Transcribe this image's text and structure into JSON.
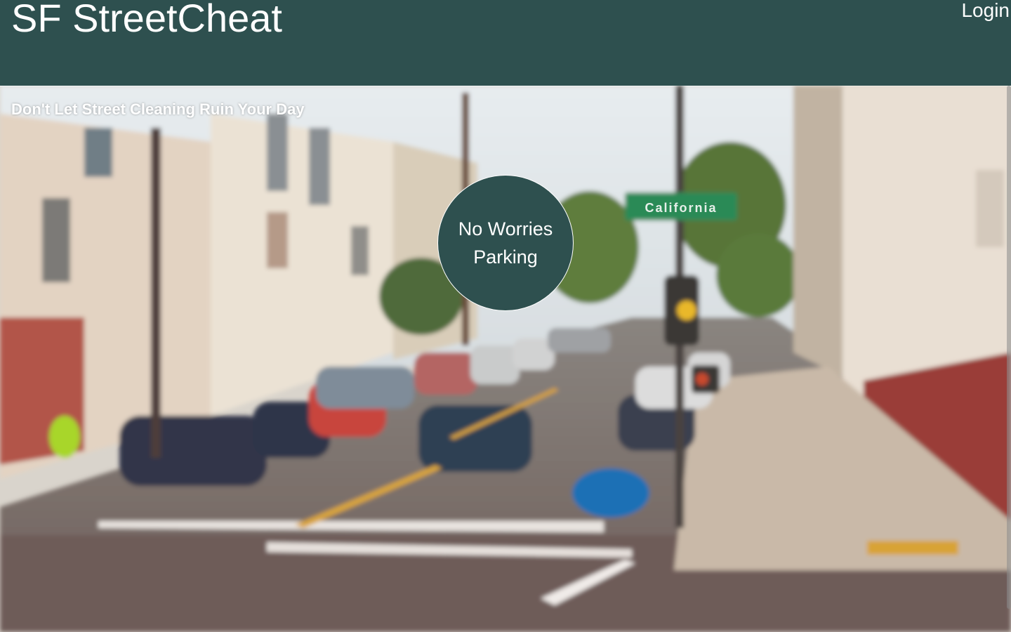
{
  "header": {
    "brand": "SF StreetCheat",
    "login_label": "Login"
  },
  "hero": {
    "tagline": "Don't Let Street Cleaning Ruin Your Day",
    "cta_line1": "No Worries",
    "cta_line2": "Parking",
    "street_sign": "California"
  },
  "colors": {
    "header_bg": "#2e504f",
    "cta_bg": "#2e504f",
    "text": "#ffffff"
  }
}
